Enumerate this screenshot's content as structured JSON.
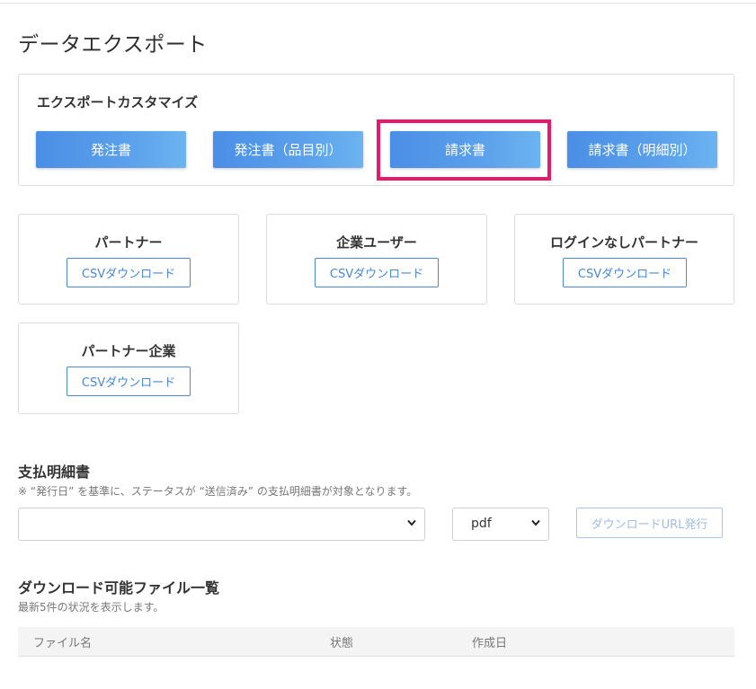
{
  "page_title": "データエクスポート",
  "customize": {
    "title": "エクスポートカスタマイズ",
    "buttons": [
      "発注書",
      "発注書（品目別）",
      "請求書",
      "請求書（明細別）"
    ]
  },
  "csv_cards": [
    {
      "title": "パートナー",
      "button": "CSVダウンロード"
    },
    {
      "title": "企業ユーザー",
      "button": "CSVダウンロード"
    },
    {
      "title": "ログインなしパートナー",
      "button": "CSVダウンロード"
    },
    {
      "title": "パートナー企業",
      "button": "CSVダウンロード"
    }
  ],
  "payment": {
    "title": "支払明細書",
    "note": "※ “発行日” を基準に、ステータスが “送信済み” の支払明細書が対象となります。",
    "period_value": "",
    "format_value": "pdf",
    "issue_button": "ダウンロードURL発行"
  },
  "downloads": {
    "title": "ダウンロード可能ファイル一覧",
    "note": "最新5件の状況を表示します。",
    "columns": [
      "ファイル名",
      "状態",
      "作成日"
    ]
  },
  "colors": {
    "primary": "#4a8fe6",
    "highlight": "#e8196a",
    "outline": "#4a87d6"
  }
}
